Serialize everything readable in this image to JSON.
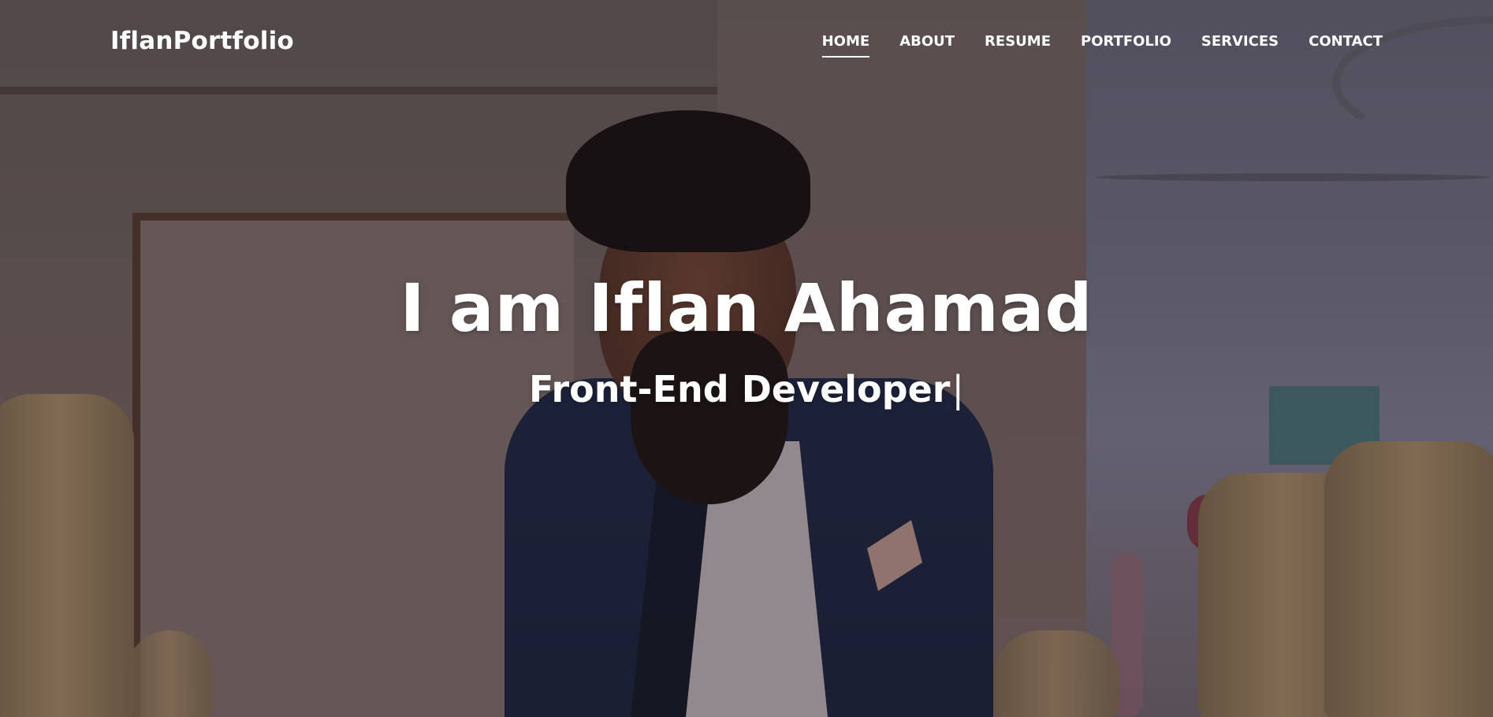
{
  "header": {
    "logo": "IflanPortfolio",
    "nav": [
      {
        "label": "HOME",
        "active": true
      },
      {
        "label": "ABOUT",
        "active": false
      },
      {
        "label": "RESUME",
        "active": false
      },
      {
        "label": "PORTFOLIO",
        "active": false
      },
      {
        "label": "SERVICES",
        "active": false
      },
      {
        "label": "CONTACT",
        "active": false
      }
    ]
  },
  "hero": {
    "title": "I am Iflan Ahamad",
    "subtitle": "Front-End Developer",
    "cursor": "|"
  },
  "colors": {
    "text": "#ffffff",
    "overlay": "rgba(30,20,25,0.35)"
  }
}
